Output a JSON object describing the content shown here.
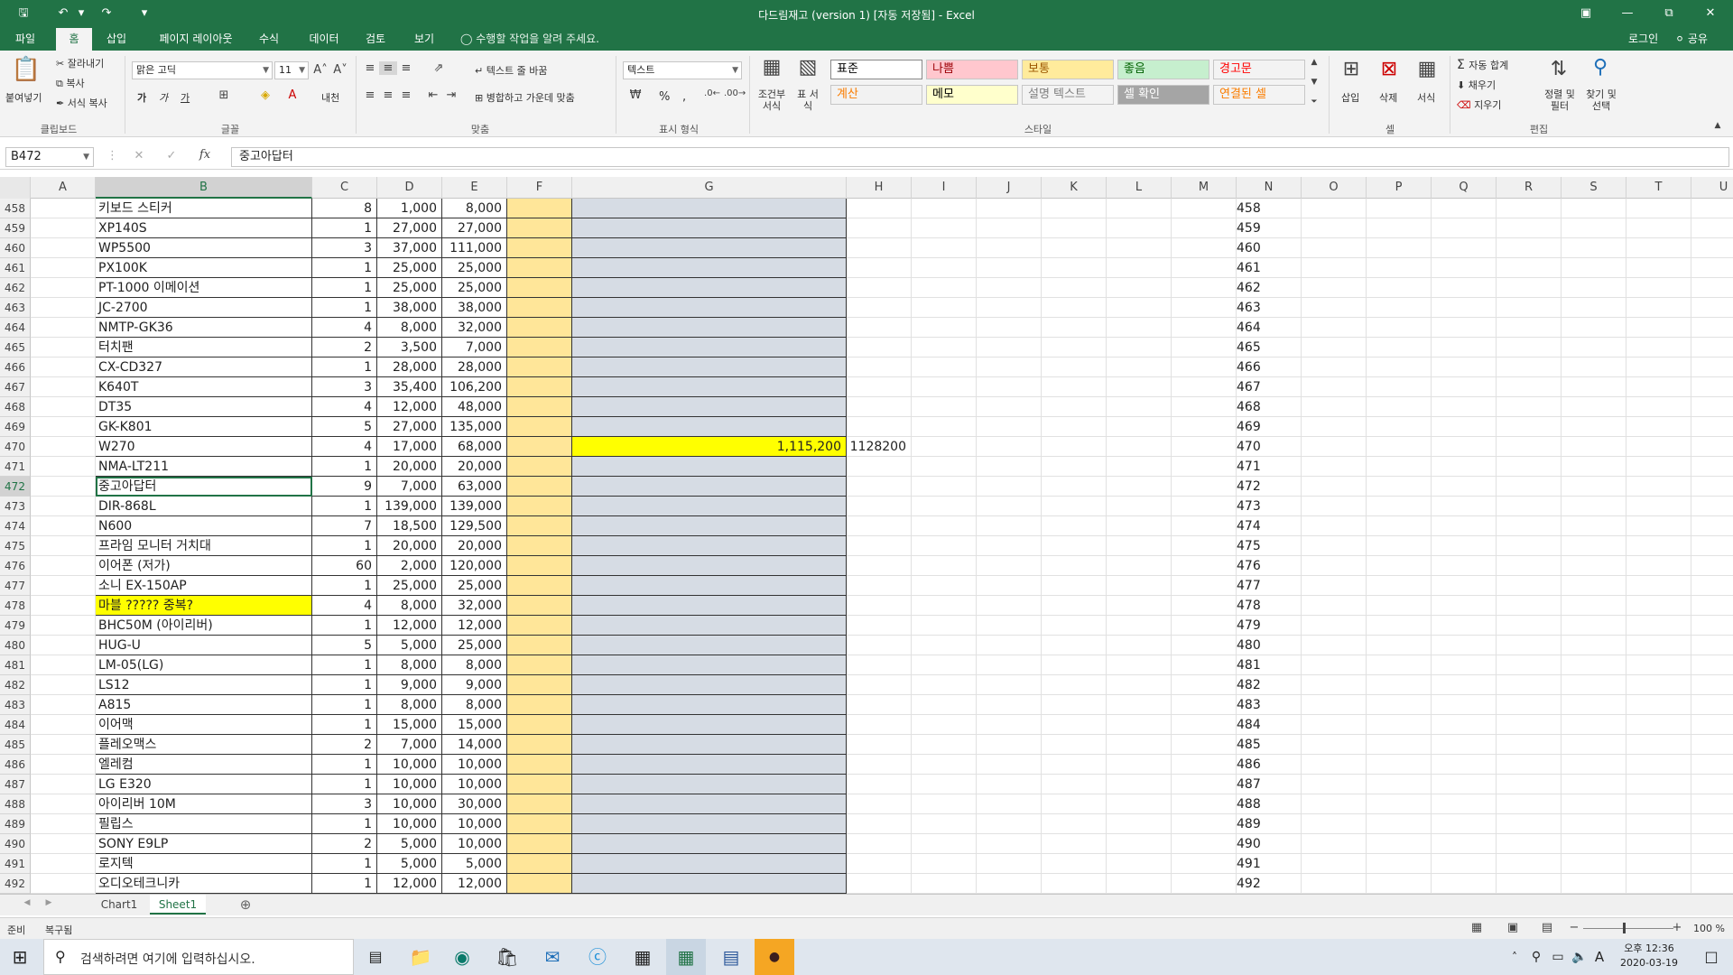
{
  "window": {
    "title": "다드림재고 (version 1) [자동 저장됨] - Excel",
    "login": "로그인",
    "share": "공유"
  },
  "tabs": [
    "파일",
    "홈",
    "삽입",
    "페이지 레이아웃",
    "수식",
    "데이터",
    "검토",
    "보기"
  ],
  "tell_me": "수행할 작업을 알려 주세요.",
  "ribbon": {
    "paste": "붙여넣기",
    "cut": "잘라내기",
    "copy": "복사",
    "format_painter": "서식 복사",
    "clipboard": "클립보드",
    "font_name": "맑은 고딕",
    "font_size": "11",
    "font_group": "글꼴",
    "bold": "가",
    "italic": "가",
    "underline": "가",
    "phonetic": "내천",
    "wrap": "텍스트 줄 바꿈",
    "merge": "병합하고 가운데 맞춤",
    "align_group": "맞춤",
    "num_format": "텍스트",
    "num_group": "표시 형식",
    "percent": "%",
    "comma": ",",
    "cond_format": "조건부 서식",
    "table_format": "표 서식",
    "styles": [
      {
        "label": "표준",
        "bg": "#ffffff",
        "fg": "#000000"
      },
      {
        "label": "나쁨",
        "bg": "#ffc7ce",
        "fg": "#9c0006"
      },
      {
        "label": "보통",
        "bg": "#ffeb9c",
        "fg": "#9c5700"
      },
      {
        "label": "좋음",
        "bg": "#c6efce",
        "fg": "#006100"
      },
      {
        "label": "경고문",
        "bg": "#f3f3f3",
        "fg": "#ff0000"
      },
      {
        "label": "계산",
        "bg": "#f2f2f2",
        "fg": "#fa7d00"
      },
      {
        "label": "메모",
        "bg": "#ffffcc",
        "fg": "#000000"
      },
      {
        "label": "설명 텍스트",
        "bg": "#f3f3f3",
        "fg": "#7f7f7f"
      },
      {
        "label": "셀 확인",
        "bg": "#a5a5a5",
        "fg": "#ffffff"
      },
      {
        "label": "연결된 셀",
        "bg": "#f3f3f3",
        "fg": "#fa7d00"
      }
    ],
    "style_group": "스타일",
    "insert": "삽입",
    "delete": "삭제",
    "format": "서식",
    "cells_group": "셀",
    "autosum": "자동 합계",
    "fill": "채우기",
    "clear": "지우기",
    "sort": "정렬 및 필터",
    "find": "찾기 및 선택",
    "edit_group": "편집"
  },
  "formula_bar": {
    "name_box": "B472",
    "content": "중고아답터"
  },
  "columns": [
    "A",
    "B",
    "C",
    "D",
    "E",
    "F",
    "G",
    "H",
    "I",
    "J",
    "K",
    "L",
    "M",
    "N",
    "O",
    "P",
    "Q",
    "R",
    "S",
    "T",
    "U"
  ],
  "rows": [
    {
      "n": "458",
      "b": "키보드 스티커",
      "c": "8",
      "d": "1,000",
      "e": "8,000"
    },
    {
      "n": "459",
      "b": "XP140S",
      "c": "1",
      "d": "27,000",
      "e": "27,000"
    },
    {
      "n": "460",
      "b": "WP5500",
      "c": "3",
      "d": "37,000",
      "e": "111,000"
    },
    {
      "n": "461",
      "b": "PX100K",
      "c": "1",
      "d": "25,000",
      "e": "25,000"
    },
    {
      "n": "462",
      "b": "PT-1000 이메이션",
      "c": "1",
      "d": "25,000",
      "e": "25,000"
    },
    {
      "n": "463",
      "b": "JC-2700",
      "c": "1",
      "d": "38,000",
      "e": "38,000"
    },
    {
      "n": "464",
      "b": "NMTP-GK36",
      "c": "4",
      "d": "8,000",
      "e": "32,000"
    },
    {
      "n": "465",
      "b": "터치팬",
      "c": "2",
      "d": "3,500",
      "e": "7,000"
    },
    {
      "n": "466",
      "b": "CX-CD327",
      "c": "1",
      "d": "28,000",
      "e": "28,000"
    },
    {
      "n": "467",
      "b": "K640T",
      "c": "3",
      "d": "35,400",
      "e": "106,200"
    },
    {
      "n": "468",
      "b": "DT35",
      "c": "4",
      "d": "12,000",
      "e": "48,000"
    },
    {
      "n": "469",
      "b": "GK-K801",
      "c": "5",
      "d": "27,000",
      "e": "135,000"
    },
    {
      "n": "470",
      "b": "W270",
      "c": "4",
      "d": "17,000",
      "e": "68,000",
      "g": "1,115,200",
      "h": "1128200"
    },
    {
      "n": "471",
      "b": "NMA-LT211",
      "c": "1",
      "d": "20,000",
      "e": "20,000"
    },
    {
      "n": "472",
      "b": "중고아답터",
      "c": "9",
      "d": "7,000",
      "e": "63,000"
    },
    {
      "n": "473",
      "b": "DIR-868L",
      "c": "1",
      "d": "139,000",
      "e": "139,000"
    },
    {
      "n": "474",
      "b": "N600",
      "c": "7",
      "d": "18,500",
      "e": "129,500"
    },
    {
      "n": "475",
      "b": "프라임 모니터 거치대",
      "c": "1",
      "d": "20,000",
      "e": "20,000"
    },
    {
      "n": "476",
      "b": "이어폰 (저가)",
      "c": "60",
      "d": "2,000",
      "e": "120,000"
    },
    {
      "n": "477",
      "b": "소니 EX-150AP",
      "c": "1",
      "d": "25,000",
      "e": "25,000"
    },
    {
      "n": "478",
      "b": "마블 ????? 중복?",
      "c": "4",
      "d": "8,000",
      "e": "32,000",
      "hl": true
    },
    {
      "n": "479",
      "b": "BHC50M (아이리버)",
      "c": "1",
      "d": "12,000",
      "e": "12,000"
    },
    {
      "n": "480",
      "b": "HUG-U",
      "c": "5",
      "d": "5,000",
      "e": "25,000"
    },
    {
      "n": "481",
      "b": "LM-05(LG)",
      "c": "1",
      "d": "8,000",
      "e": "8,000"
    },
    {
      "n": "482",
      "b": "LS12",
      "c": "1",
      "d": "9,000",
      "e": "9,000"
    },
    {
      "n": "483",
      "b": "A815",
      "c": "1",
      "d": "8,000",
      "e": "8,000"
    },
    {
      "n": "484",
      "b": "이어맥",
      "c": "1",
      "d": "15,000",
      "e": "15,000"
    },
    {
      "n": "485",
      "b": "플레오맥스",
      "c": "2",
      "d": "7,000",
      "e": "14,000"
    },
    {
      "n": "486",
      "b": "엘레컴",
      "c": "1",
      "d": "10,000",
      "e": "10,000"
    },
    {
      "n": "487",
      "b": "LG E320",
      "c": "1",
      "d": "10,000",
      "e": "10,000"
    },
    {
      "n": "488",
      "b": "아이리버 10M",
      "c": "3",
      "d": "10,000",
      "e": "30,000"
    },
    {
      "n": "489",
      "b": "필립스",
      "c": "1",
      "d": "10,000",
      "e": "10,000"
    },
    {
      "n": "490",
      "b": "SONY E9LP",
      "c": "2",
      "d": "5,000",
      "e": "10,000"
    },
    {
      "n": "491",
      "b": "로지텍",
      "c": "1",
      "d": "5,000",
      "e": "5,000"
    },
    {
      "n": "492",
      "b": "오디오테크니카",
      "c": "1",
      "d": "12,000",
      "e": "12,000"
    }
  ],
  "sheets": [
    "Chart1",
    "Sheet1"
  ],
  "status": {
    "ready": "준비",
    "recovered": "복구됨",
    "zoom": "100 %"
  },
  "taskbar": {
    "search": "검색하려면 여기에 입력하십시오.",
    "time": "오후 12:36",
    "date": "2020-03-19",
    "ime": "A"
  },
  "colors": {
    "accent": "#217346",
    "yellow": "#ffff00",
    "f_fill": "#ffe699",
    "g_fill": "#d6dce4"
  }
}
